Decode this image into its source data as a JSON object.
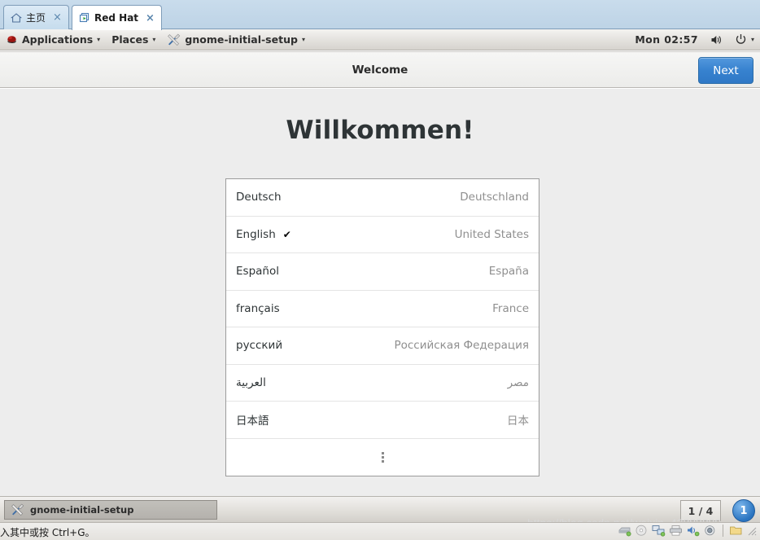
{
  "vmware": {
    "tabs": [
      {
        "label": "主页",
        "icon": "home-icon",
        "active": false,
        "close": "×"
      },
      {
        "label": "Red Hat",
        "icon": "vm-icon",
        "active": true,
        "close": "×"
      }
    ],
    "status_hint": "指针移入其中或按 Ctrl+G。",
    "watermark": "https://blog.csdn.net/weixin_42882099",
    "tray_icons": [
      "harddisk-icon",
      "cdrom-icon",
      "network-icon",
      "printer-icon",
      "sound-icon",
      "camera-icon",
      "folder-icon"
    ]
  },
  "gnome_panel": {
    "applications_label": "Applications",
    "places_label": "Places",
    "window_label": "gnome-initial-setup",
    "clock": "Mon 02:57",
    "redhat_logo": "redhat-shadowman-icon",
    "window_icon": "tools-icon",
    "volume_icon": "volume-icon",
    "power_icon": "power-icon",
    "caret": "▾"
  },
  "app": {
    "title": "Welcome",
    "next_label": "Next",
    "heading": "Willkommen!",
    "accent_color": "#3782cf"
  },
  "languages": [
    {
      "name": "Deutsch",
      "country": "Deutschland",
      "selected": false,
      "check": ""
    },
    {
      "name": "English",
      "country": "United States",
      "selected": true,
      "check": "✔"
    },
    {
      "name": "Español",
      "country": "España",
      "selected": false,
      "check": ""
    },
    {
      "name": "français",
      "country": "France",
      "selected": false,
      "check": ""
    },
    {
      "name": "русский",
      "country": "Российская Федерация",
      "selected": false,
      "check": ""
    },
    {
      "name": "العربية",
      "country": "مصر",
      "selected": false,
      "check": ""
    },
    {
      "name": "日本語",
      "country": "日本",
      "selected": false,
      "check": ""
    }
  ],
  "taskbar": {
    "task_label": "gnome-initial-setup",
    "task_icon": "tools-icon",
    "page_indicator": "1 / 4",
    "workspace_badge": "1"
  }
}
